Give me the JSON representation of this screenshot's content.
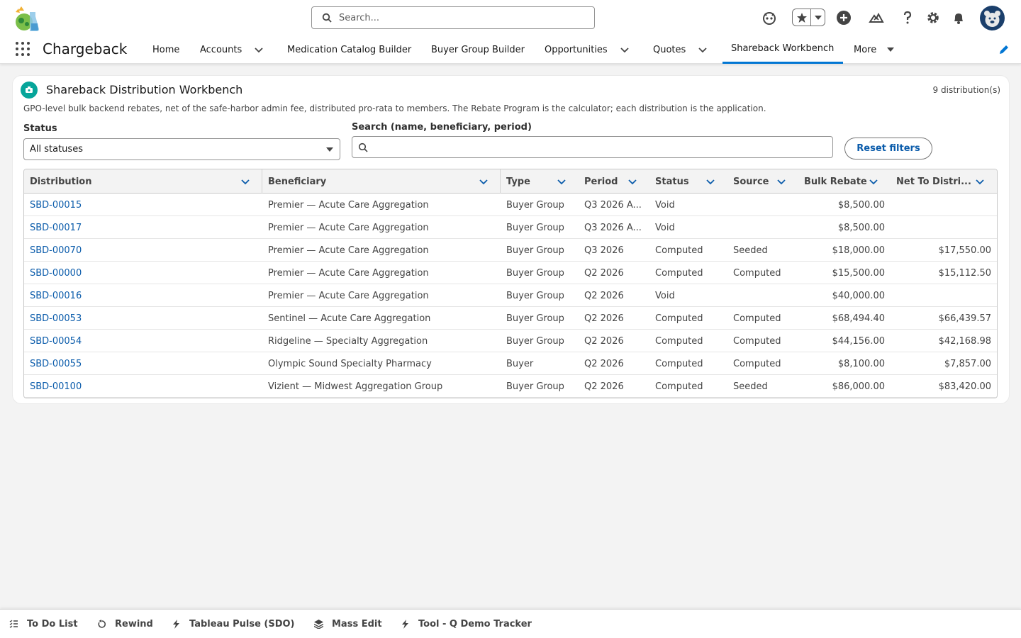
{
  "header": {
    "search_placeholder": "Search...",
    "icons": [
      "einstein-icon",
      "favorites-star-icon",
      "add-icon",
      "trailhead-icon",
      "help-icon",
      "setup-gear-icon",
      "notifications-bell-icon",
      "avatar"
    ]
  },
  "nav": {
    "app_name": "Chargeback",
    "items": [
      {
        "label": "Home",
        "has_menu": false
      },
      {
        "label": "Accounts",
        "has_menu": true
      },
      {
        "label": "Medication Catalog Builder",
        "has_menu": false
      },
      {
        "label": "Buyer Group Builder",
        "has_menu": false
      },
      {
        "label": "Opportunities",
        "has_menu": true
      },
      {
        "label": "Quotes",
        "has_menu": true
      },
      {
        "label": "Shareback Workbench",
        "has_menu": false,
        "active": true
      },
      {
        "label": "More",
        "has_menu": true
      }
    ],
    "accent_color": "#0176d3"
  },
  "card": {
    "title": "Shareback Distribution Workbench",
    "count": "9 distribution(s)",
    "description": "GPO-level bulk backend rebates, net of the safe-harbor admin fee, distributed pro-rata to members. The Rebate Program is the calculator; each distribution is the application.",
    "filters": {
      "status_label": "Status",
      "status_value": "All statuses",
      "search_label": "Search (name, beneficiary, period)",
      "search_value": "",
      "reset_label": "Reset filters"
    }
  },
  "table": {
    "columns": [
      "Distribution",
      "Beneficiary",
      "Type",
      "Period",
      "Status",
      "Source",
      "Bulk Rebate",
      "Net To Distri..."
    ],
    "rows": [
      {
        "distribution": "SBD-00015",
        "beneficiary": "Premier — Acute Care Aggregation",
        "type": "Buyer Group",
        "period": "Q3 2026 A...",
        "status": "Void",
        "source": "",
        "bulk_rebate": "$8,500.00",
        "net": ""
      },
      {
        "distribution": "SBD-00017",
        "beneficiary": "Premier — Acute Care Aggregation",
        "type": "Buyer Group",
        "period": "Q3 2026 A...",
        "status": "Void",
        "source": "",
        "bulk_rebate": "$8,500.00",
        "net": ""
      },
      {
        "distribution": "SBD-00070",
        "beneficiary": "Premier — Acute Care Aggregation",
        "type": "Buyer Group",
        "period": "Q3 2026",
        "status": "Computed",
        "source": "Seeded",
        "bulk_rebate": "$18,000.00",
        "net": "$17,550.00"
      },
      {
        "distribution": "SBD-00000",
        "beneficiary": "Premier — Acute Care Aggregation",
        "type": "Buyer Group",
        "period": "Q2 2026",
        "status": "Computed",
        "source": "Computed",
        "bulk_rebate": "$15,500.00",
        "net": "$15,112.50"
      },
      {
        "distribution": "SBD-00016",
        "beneficiary": "Premier — Acute Care Aggregation",
        "type": "Buyer Group",
        "period": "Q2 2026",
        "status": "Void",
        "source": "",
        "bulk_rebate": "$40,000.00",
        "net": ""
      },
      {
        "distribution": "SBD-00053",
        "beneficiary": "Sentinel — Acute Care Aggregation",
        "type": "Buyer Group",
        "period": "Q2 2026",
        "status": "Computed",
        "source": "Computed",
        "bulk_rebate": "$68,494.40",
        "net": "$66,439.57"
      },
      {
        "distribution": "SBD-00054",
        "beneficiary": "Ridgeline — Specialty Aggregation",
        "type": "Buyer Group",
        "period": "Q2 2026",
        "status": "Computed",
        "source": "Computed",
        "bulk_rebate": "$44,156.00",
        "net": "$42,168.98"
      },
      {
        "distribution": "SBD-00055",
        "beneficiary": "Olympic Sound Specialty Pharmacy",
        "type": "Buyer",
        "period": "Q2 2026",
        "status": "Computed",
        "source": "Computed",
        "bulk_rebate": "$8,100.00",
        "net": "$7,857.00"
      },
      {
        "distribution": "SBD-00100",
        "beneficiary": "Vizient — Midwest Aggregation Group",
        "type": "Buyer Group",
        "period": "Q2 2026",
        "status": "Computed",
        "source": "Seeded",
        "bulk_rebate": "$86,000.00",
        "net": "$83,420.00"
      }
    ]
  },
  "utility_bar": {
    "items": [
      {
        "label": "To Do List",
        "icon": "checklist-icon"
      },
      {
        "label": "Rewind",
        "icon": "rewind-icon"
      },
      {
        "label": "Tableau Pulse (SDO)",
        "icon": "bolt-icon"
      },
      {
        "label": "Mass Edit",
        "icon": "layers-icon"
      },
      {
        "label": "Tool - Q Demo Tracker",
        "icon": "bolt-icon"
      }
    ]
  }
}
